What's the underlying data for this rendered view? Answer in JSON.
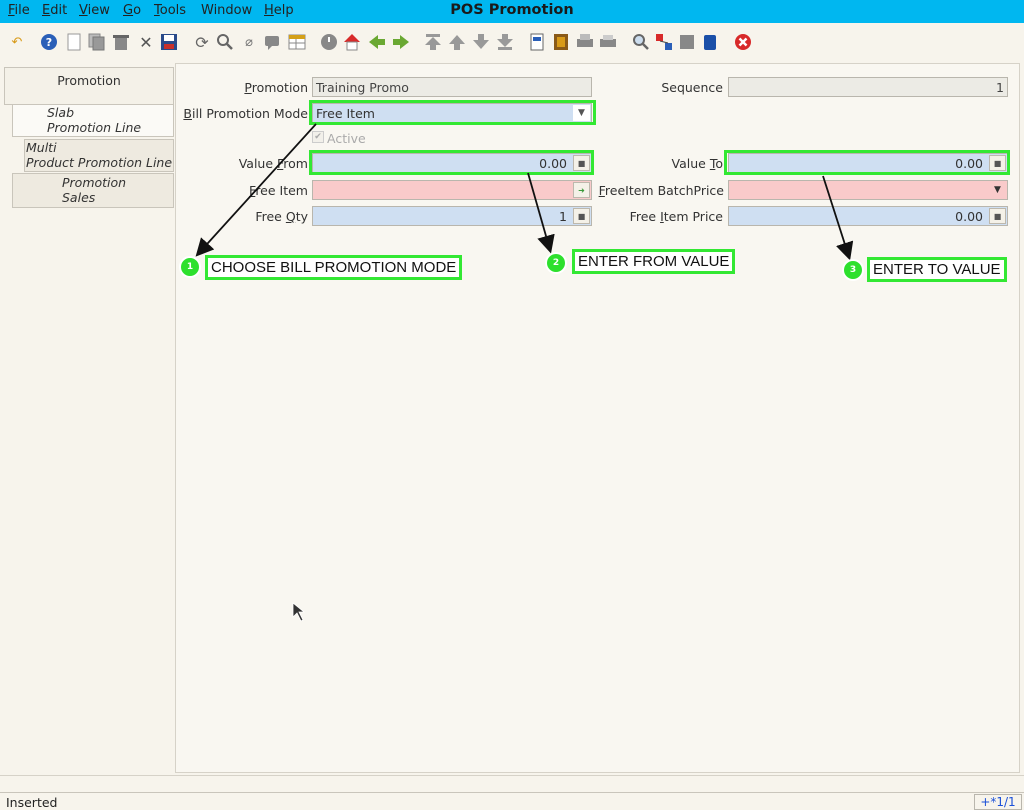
{
  "window": {
    "title": "POS Promotion"
  },
  "menu": [
    {
      "key": "F",
      "rest": "ile"
    },
    {
      "key": "E",
      "rest": "dit"
    },
    {
      "key": "V",
      "rest": "iew"
    },
    {
      "key": "G",
      "rest": "o"
    },
    {
      "key": "T",
      "rest": "ools"
    },
    {
      "key": "",
      "rest": "Window"
    },
    {
      "key": "H",
      "rest": "elp"
    }
  ],
  "toolbar_icons": [
    "undo-icon",
    "help-icon",
    "new-record-icon",
    "copy-record-icon",
    "delete-icon",
    "delete-selection-icon",
    "save-icon",
    "refresh-icon",
    "find-icon",
    "attachment-icon",
    "chat-icon",
    "grid-toggle-icon",
    "history-icon",
    "home-icon",
    "parent-icon",
    "detail-icon",
    "first-record-icon",
    "previous-record-icon",
    "next-record-icon",
    "last-record-icon",
    "report-icon",
    "archive-icon",
    "print-preview-icon",
    "print-icon",
    "zoom-across-icon",
    "active-workflows-icon",
    "request-icon",
    "product-info-icon",
    "close-window-icon"
  ],
  "tabs": [
    {
      "line1": "Promotion",
      "line2": ""
    },
    {
      "line1": "Slab",
      "line2": "Promotion Line"
    },
    {
      "line1": "Multi",
      "line2": "Product Promotion Line"
    },
    {
      "line1": "Promotion",
      "line2": "Sales"
    }
  ],
  "form": {
    "promotion": {
      "label_key": "P",
      "label_rest": "romotion",
      "value": "Training Promo"
    },
    "sequence": {
      "label": "Sequence",
      "value": "1"
    },
    "bill_promotion_mode": {
      "label_key": "B",
      "label_rest": "ill Promotion Mode",
      "value": "Free Item"
    },
    "active": {
      "label": "Active",
      "checked": true
    },
    "value_from": {
      "label_pre": "Value ",
      "label_key": "F",
      "label_rest": "rom",
      "value": "0.00"
    },
    "value_to": {
      "label_pre": "Value ",
      "label_key": "T",
      "label_rest": "o",
      "value": "0.00"
    },
    "free_item": {
      "label_key": "F",
      "label_rest": "ree Item",
      "value": ""
    },
    "freeitem_batchprice": {
      "label_key": "F",
      "label_rest": "reeItem BatchPrice",
      "value": ""
    },
    "free_qty": {
      "label_pre": "Free ",
      "label_key": "Q",
      "label_rest": "ty",
      "value": "1"
    },
    "free_item_price": {
      "label_pre": "Free ",
      "label_key": "I",
      "label_rest": "tem Price",
      "value": "0.00"
    }
  },
  "callouts": [
    {
      "number": "1",
      "text": "CHOOSE BILL PROMOTION MODE"
    },
    {
      "number": "2",
      "text": "ENTER FROM VALUE"
    },
    {
      "number": "3",
      "text": "ENTER TO VALUE"
    }
  ],
  "status": {
    "message": "Inserted",
    "record": "+*1/1"
  },
  "colors": {
    "menubar": "#00b7f0",
    "highlight": "#33e833",
    "mandatory": "#f9caca",
    "editable": "#cfdff2"
  }
}
